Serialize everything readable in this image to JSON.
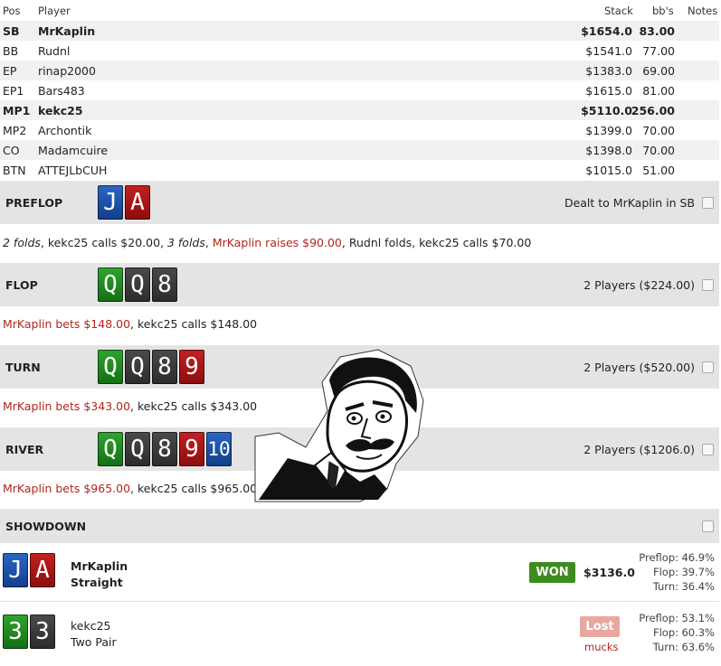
{
  "header": {
    "pos": "Pos",
    "player": "Player",
    "stack": "Stack",
    "bbs": "bb's",
    "notes": "Notes"
  },
  "players": [
    {
      "pos": "SB",
      "name": "MrKaplin",
      "stack": "$1654.0",
      "bb": "83.00",
      "bold": true
    },
    {
      "pos": "BB",
      "name": "Rudnl",
      "stack": "$1541.0",
      "bb": "77.00"
    },
    {
      "pos": "EP",
      "name": "rinap2000",
      "stack": "$1383.0",
      "bb": "69.00"
    },
    {
      "pos": "EP1",
      "name": "Bars483",
      "stack": "$1615.0",
      "bb": "81.00"
    },
    {
      "pos": "MP1",
      "name": "kekc25",
      "stack": "$5110.0",
      "bb": "256.00",
      "bold": true
    },
    {
      "pos": "MP2",
      "name": "Archontik",
      "stack": "$1399.0",
      "bb": "70.00"
    },
    {
      "pos": "CO",
      "name": "Madamcuire",
      "stack": "$1398.0",
      "bb": "70.00"
    },
    {
      "pos": "BTN",
      "name": "ATTEJLbCUH",
      "stack": "$1015.0",
      "bb": "51.00"
    }
  ],
  "streets": {
    "preflop": {
      "name": "PREFLOP",
      "info": "Dealt to MrKaplin in SB",
      "cards": [
        {
          "r": "J",
          "s": "d"
        },
        {
          "r": "A",
          "s": "h"
        }
      ],
      "actions": {
        "a1": "2 folds",
        "a2": ", kekc25 calls $20.00, ",
        "a3": "3 folds",
        "a4": ", ",
        "a5": "MrKaplin raises $90.00",
        "a6": ", Rudnl folds, kekc25 calls $70.00"
      }
    },
    "flop": {
      "name": "FLOP",
      "info": "2 Players ($224.00)",
      "cards": [
        {
          "r": "Q",
          "s": "c"
        },
        {
          "r": "Q",
          "s": "s"
        },
        {
          "r": "8",
          "s": "s"
        }
      ],
      "actions": {
        "a1": "MrKaplin bets $148.00",
        "a2": ", kekc25 calls $148.00"
      }
    },
    "turn": {
      "name": "TURN",
      "info": "2 Players ($520.00)",
      "cards": [
        {
          "r": "Q",
          "s": "c"
        },
        {
          "r": "Q",
          "s": "s"
        },
        {
          "r": "8",
          "s": "s"
        },
        {
          "r": "9",
          "s": "h"
        }
      ],
      "actions": {
        "a1": "MrKaplin bets $343.00",
        "a2": ", kekc25 calls $343.00"
      }
    },
    "river": {
      "name": "RIVER",
      "info": "2 Players ($1206.0)",
      "cards": [
        {
          "r": "Q",
          "s": "c"
        },
        {
          "r": "Q",
          "s": "s"
        },
        {
          "r": "8",
          "s": "s"
        },
        {
          "r": "9",
          "s": "h"
        },
        {
          "r": "10",
          "s": "d"
        }
      ],
      "actions": {
        "a1": "MrKaplin bets $965.00",
        "a2": ", kekc25 calls $965.00"
      }
    },
    "showdown": {
      "name": "SHOWDOWN"
    }
  },
  "showdown": [
    {
      "name": "MrKaplin",
      "hand": "Straight",
      "result": "WON",
      "amount": "$3136.0",
      "cards": [
        {
          "r": "J",
          "s": "d"
        },
        {
          "r": "A",
          "s": "h"
        }
      ],
      "eq_labels": [
        "Preflop:",
        "Flop:",
        "Turn:"
      ],
      "eq": [
        "46.9%",
        "39.7%",
        "36.4%"
      ]
    },
    {
      "name": "kekc25",
      "hand": "Two Pair",
      "result": "Lost",
      "note": "mucks",
      "cards": [
        {
          "r": "3",
          "s": "c"
        },
        {
          "r": "3",
          "s": "s"
        }
      ],
      "eq_labels": [
        "Preflop:",
        "Flop:",
        "Turn:"
      ],
      "eq": [
        "53.1%",
        "60.3%",
        "63.6%"
      ]
    }
  ],
  "colors": {
    "action_red": "#b2261b",
    "won_green": "#3d8c1e",
    "lost_pink": "#e8a8a0",
    "spade": "#3a3a3a",
    "heart": "#a81818",
    "diamond": "#1f52a8",
    "club": "#238a23"
  },
  "meme": {
    "icon": "are-you-kidding-me-meme"
  }
}
